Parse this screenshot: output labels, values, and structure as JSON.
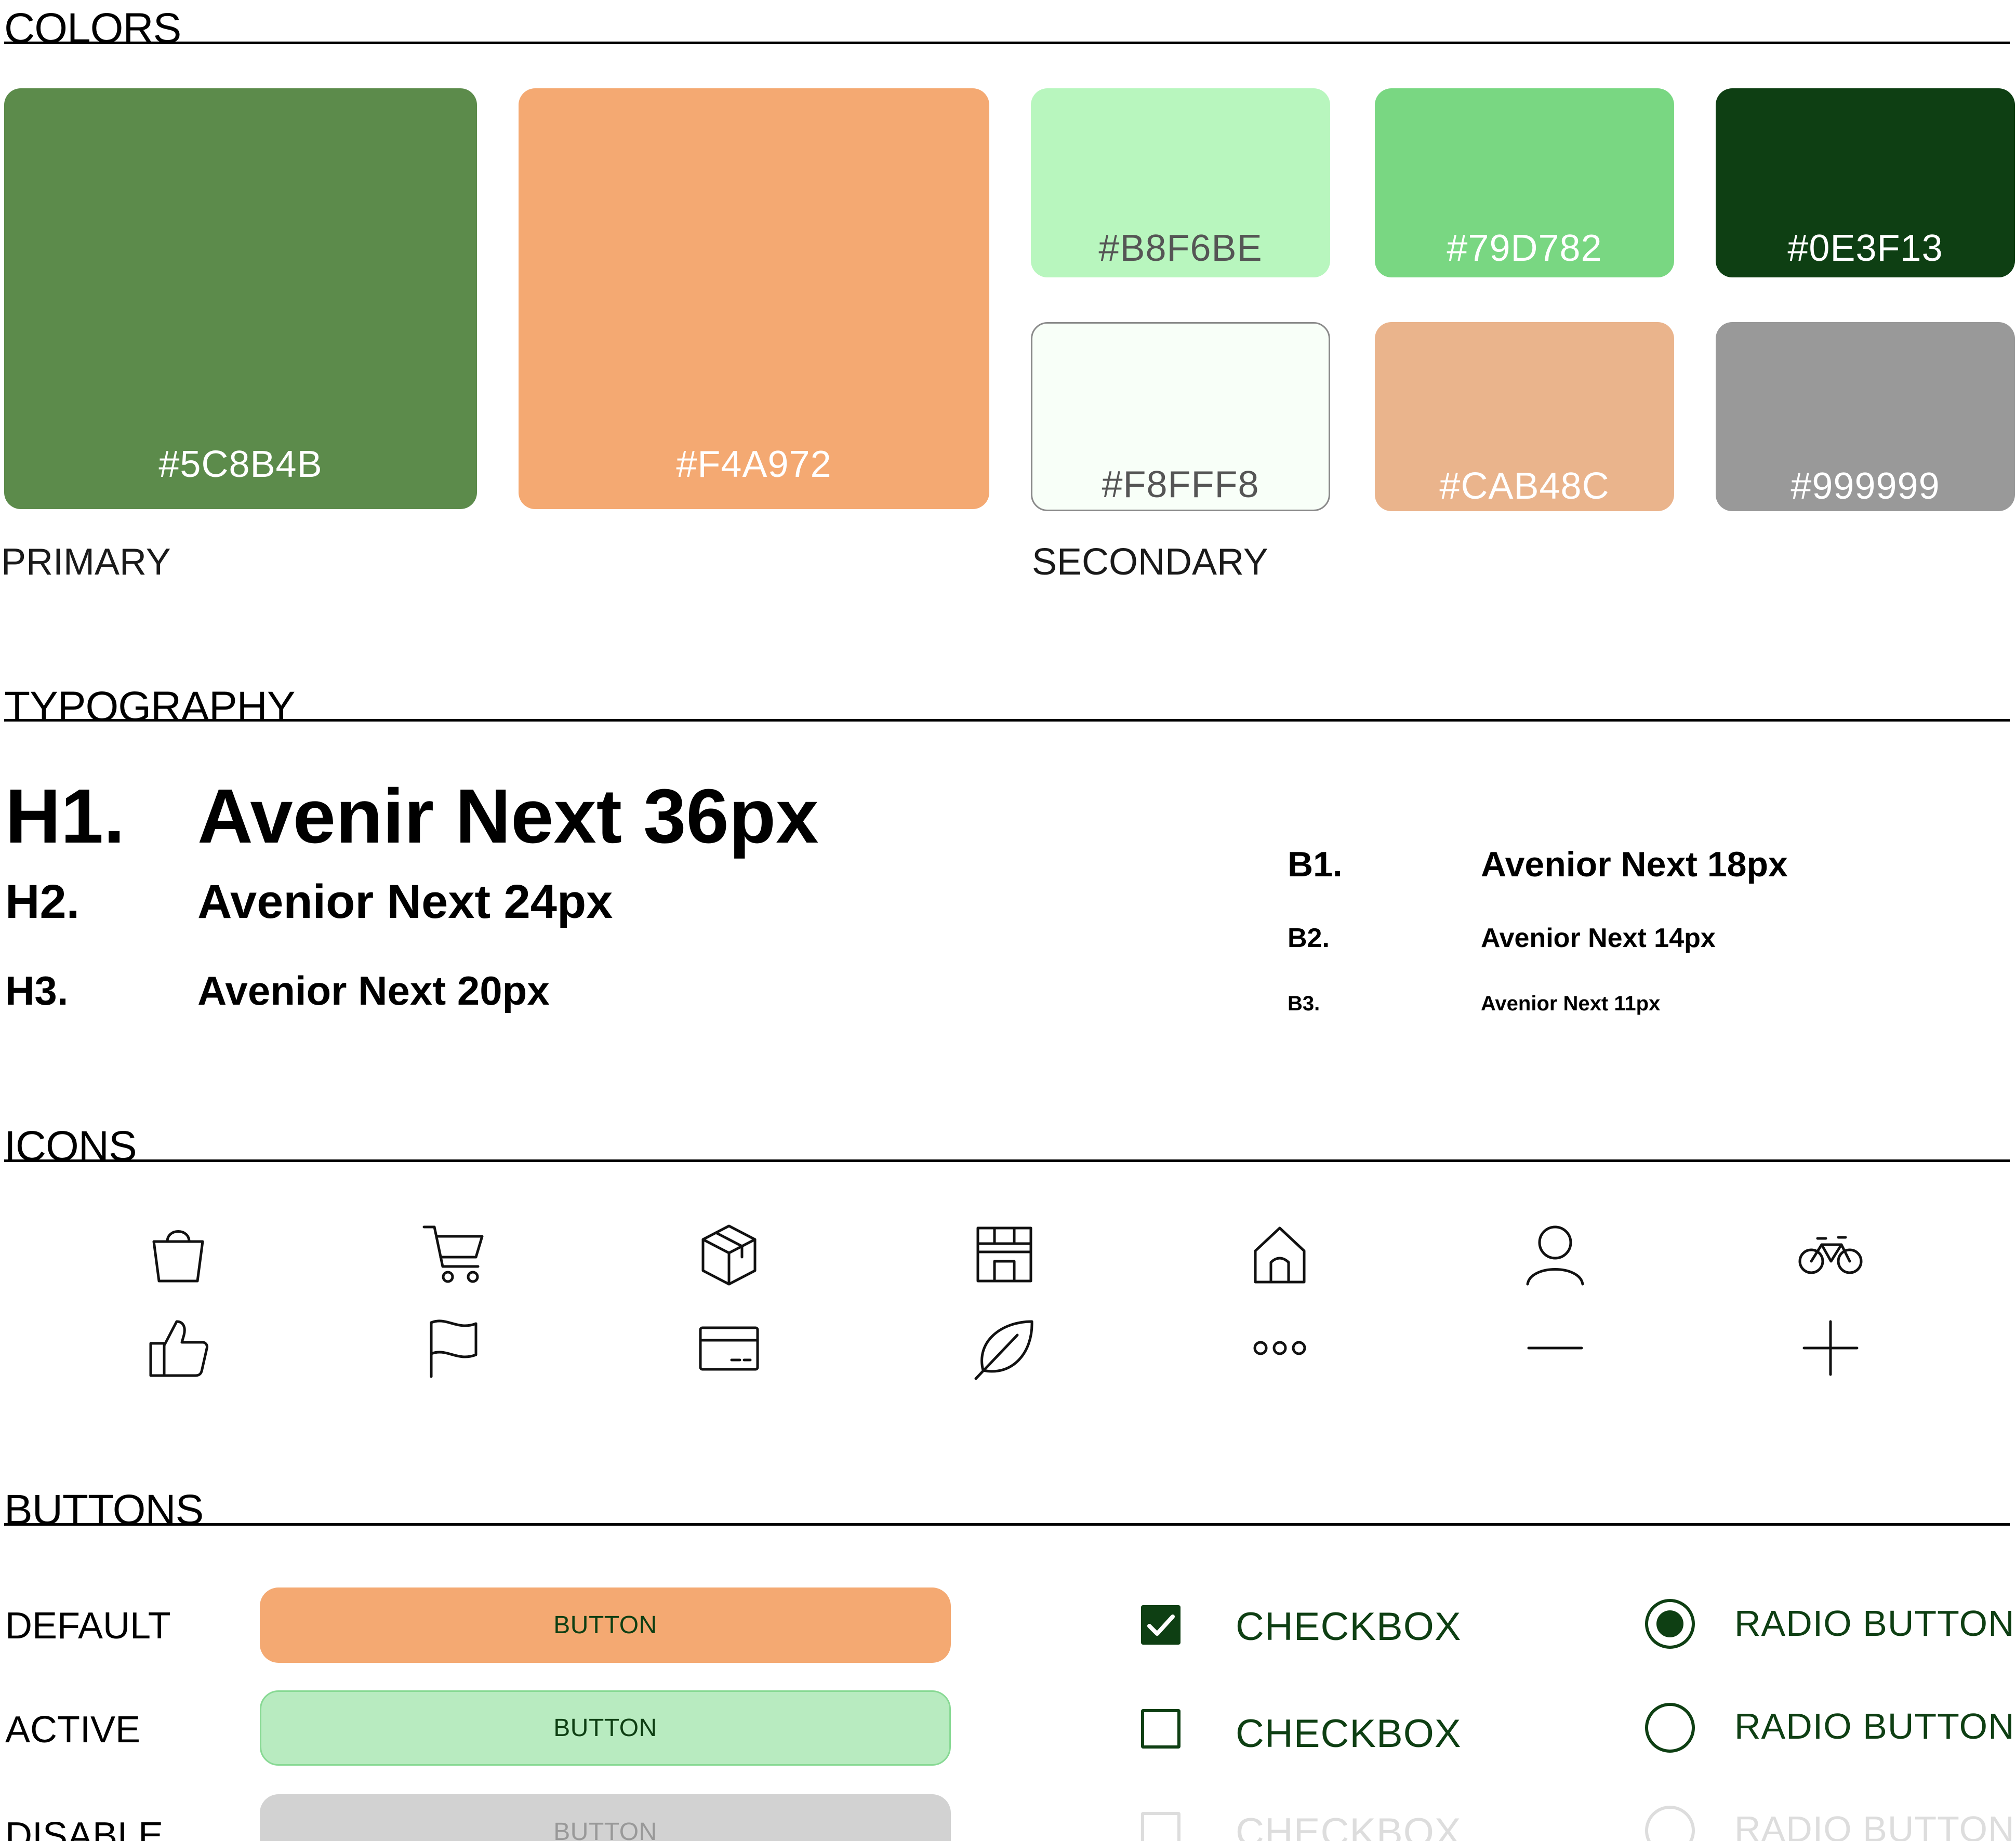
{
  "sections": {
    "colors": "COLORS",
    "typography": "TYPOGRAPHY",
    "icons": "ICONS",
    "buttons": "BUTTONS"
  },
  "colors": {
    "primary_label": "PRIMARY",
    "secondary_label": "SECONDARY",
    "primary": [
      {
        "hex": "#5C8B4B",
        "color": "#5C8B4B",
        "text_color": "#ffffff"
      },
      {
        "hex": "#F4A972",
        "color": "#F4A972",
        "text_color": "#ffffff"
      }
    ],
    "secondary": [
      {
        "hex": "#B8F6BE",
        "color": "#B8F6BE",
        "text_color": "#555555"
      },
      {
        "hex": "#79D782",
        "color": "#79D782",
        "text_color": "#ffffff"
      },
      {
        "hex": "#0E3F13",
        "color": "#0E3F13",
        "text_color": "#ffffff"
      },
      {
        "hex": "#F8FFF8",
        "color": "#F8FFF8",
        "text_color": "#555555"
      },
      {
        "hex": "#CAB48C",
        "color": "#EAB48C",
        "text_color": "#ffffff"
      },
      {
        "hex": "#999999",
        "color": "#999999",
        "text_color": "#ffffff"
      }
    ]
  },
  "typography": {
    "h1": {
      "tag": "H1.",
      "sample": "Avenir Next 36px"
    },
    "h2": {
      "tag": "H2.",
      "sample": "Avenior Next 24px"
    },
    "h3": {
      "tag": "H3.",
      "sample": "Avenior Next 20px"
    },
    "b1": {
      "tag": "B1.",
      "sample": "Avenior Next 18px"
    },
    "b2": {
      "tag": "B2.",
      "sample": "Avenior Next 14px"
    },
    "b3": {
      "tag": "B3.",
      "sample": "Avenior Next 11px"
    }
  },
  "icons": {
    "row1": [
      "shopping-bag-icon",
      "shopping-cart-icon",
      "package-box-icon",
      "storefront-icon",
      "home-icon",
      "user-icon",
      "bicycle-icon"
    ],
    "row2": [
      "thumbs-up-icon",
      "flag-icon",
      "credit-card-icon",
      "leaf-icon",
      "more-dots-icon",
      "minus-icon",
      "plus-icon"
    ]
  },
  "buttons": {
    "default": {
      "label": "DEFAULT",
      "button_text": "BUTTON",
      "bg": "#F4A972",
      "text_color": "#0E3F13"
    },
    "active": {
      "label": "ACTIVE",
      "button_text": "BUTTON",
      "bg": "#B8EBC0",
      "text_color": "#0E3F13"
    },
    "disable": {
      "label": "DISABLE",
      "button_text": "BUTTON",
      "bg": "#D2D2D2",
      "text_color": "#999999"
    },
    "checkbox": [
      {
        "label": "CHECKBOX",
        "state": "checked"
      },
      {
        "label": "CHECKBOX",
        "state": "unchecked"
      },
      {
        "label": "CHECKBOX",
        "state": "disabled"
      }
    ],
    "radio": [
      {
        "label": "RADIO BUTTON",
        "state": "selected"
      },
      {
        "label": "RADIO BUTTON",
        "state": "unselected"
      },
      {
        "label": "RADIO BUTTON",
        "state": "disabled"
      }
    ],
    "accent": "#0E3F13",
    "disabled_color": "#DDDDDD"
  }
}
